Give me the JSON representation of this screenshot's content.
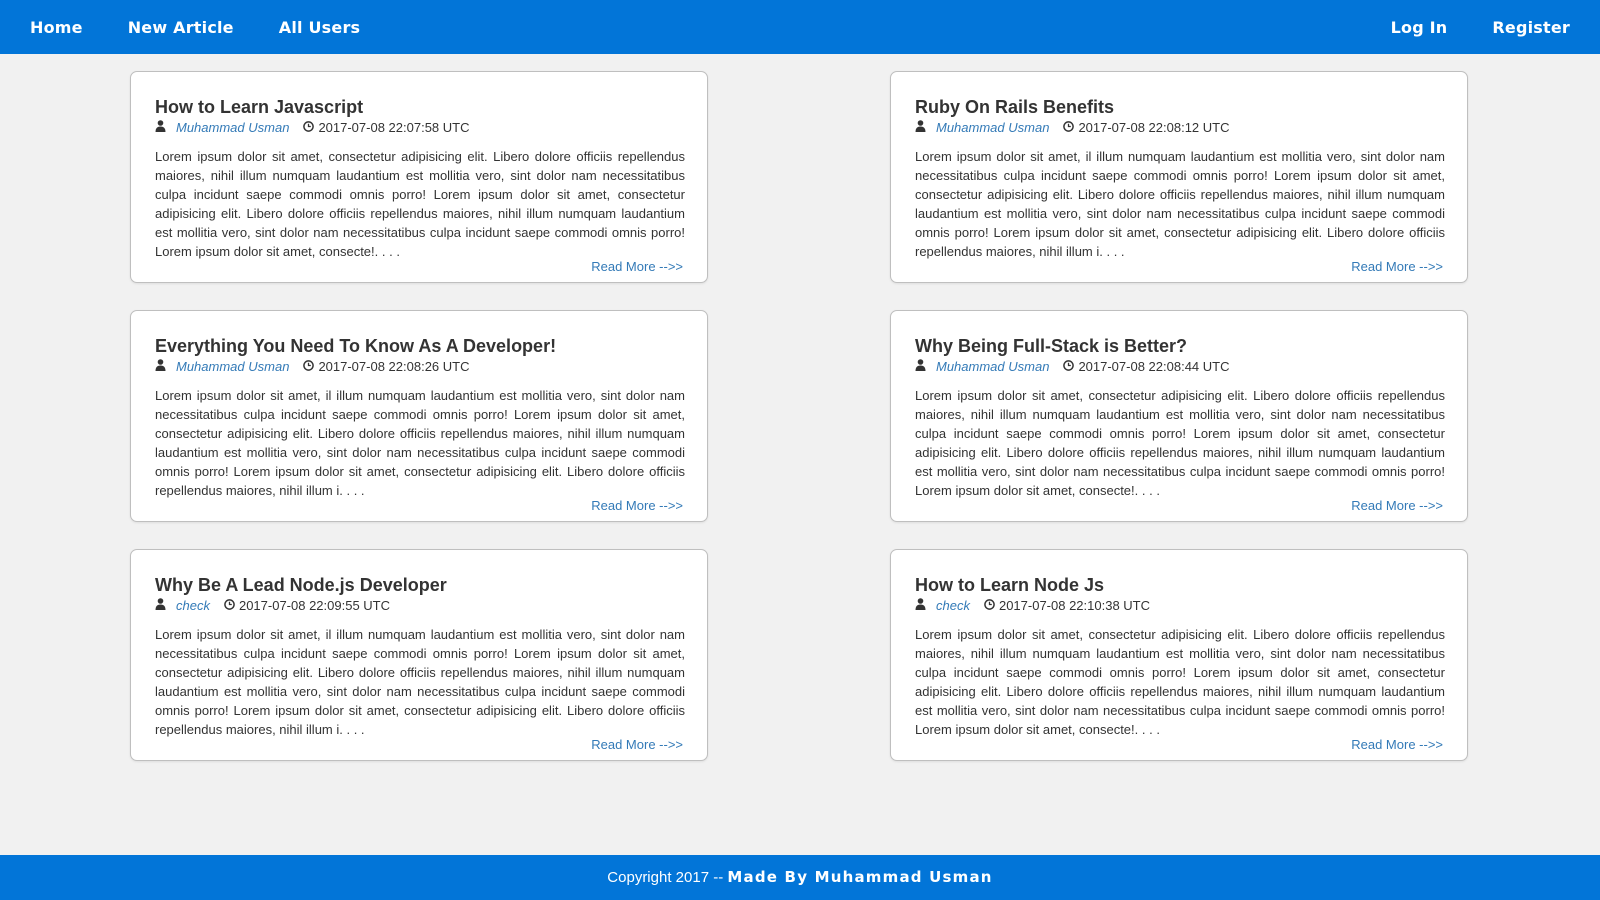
{
  "nav": {
    "left": [
      "Home",
      "New Article",
      "All Users"
    ],
    "right": [
      "Log In",
      "Register"
    ]
  },
  "articles": [
    {
      "title": "How to Learn Javascript",
      "author": "Muhammad Usman",
      "date": "2017-07-08 22:07:58 UTC",
      "excerpt": "Lorem ipsum dolor sit amet, consectetur adipisicing elit. Libero dolore officiis repellendus maiores, nihil illum numquam laudantium est mollitia vero, sint dolor nam necessitatibus culpa incidunt saepe commodi omnis porro! Lorem ipsum dolor sit amet, consectetur adipisicing elit. Libero dolore officiis repellendus maiores, nihil illum numquam laudantium est mollitia vero, sint dolor nam necessitatibus culpa incidunt saepe commodi omnis porro! Lorem ipsum dolor sit amet, consecte!. . . .",
      "read_more": "Read More -->>"
    },
    {
      "title": "Ruby On Rails Benefits",
      "author": "Muhammad Usman",
      "date": "2017-07-08 22:08:12 UTC",
      "excerpt": "Lorem ipsum dolor sit amet, il illum numquam laudantium est mollitia vero, sint dolor nam necessitatibus culpa incidunt saepe commodi omnis porro! Lorem ipsum dolor sit amet, consectetur adipisicing elit. Libero dolore officiis repellendus maiores, nihil illum numquam laudantium est mollitia vero, sint dolor nam necessitatibus culpa incidunt saepe commodi omnis porro! Lorem ipsum dolor sit amet, consectetur adipisicing elit. Libero dolore officiis repellendus maiores, nihil illum i. . . .",
      "read_more": "Read More -->>"
    },
    {
      "title": "Everything You Need To Know As A Developer!",
      "author": "Muhammad Usman",
      "date": "2017-07-08 22:08:26 UTC",
      "excerpt": "Lorem ipsum dolor sit amet, il illum numquam laudantium est mollitia vero, sint dolor nam necessitatibus culpa incidunt saepe commodi omnis porro! Lorem ipsum dolor sit amet, consectetur adipisicing elit. Libero dolore officiis repellendus maiores, nihil illum numquam laudantium est mollitia vero, sint dolor nam necessitatibus culpa incidunt saepe commodi omnis porro! Lorem ipsum dolor sit amet, consectetur adipisicing elit. Libero dolore officiis repellendus maiores, nihil illum i. . . .",
      "read_more": "Read More -->>"
    },
    {
      "title": "Why Being Full-Stack is Better?",
      "author": "Muhammad Usman",
      "date": "2017-07-08 22:08:44 UTC",
      "excerpt": "Lorem ipsum dolor sit amet, consectetur adipisicing elit. Libero dolore officiis repellendus maiores, nihil illum numquam laudantium est mollitia vero, sint dolor nam necessitatibus culpa incidunt saepe commodi omnis porro! Lorem ipsum dolor sit amet, consectetur adipisicing elit. Libero dolore officiis repellendus maiores, nihil illum numquam laudantium est mollitia vero, sint dolor nam necessitatibus culpa incidunt saepe commodi omnis porro! Lorem ipsum dolor sit amet, consecte!. . . .",
      "read_more": "Read More -->>"
    },
    {
      "title": "Why Be A Lead Node.js Developer",
      "author": "check",
      "date": "2017-07-08 22:09:55 UTC",
      "excerpt": "Lorem ipsum dolor sit amet, il illum numquam laudantium est mollitia vero, sint dolor nam necessitatibus culpa incidunt saepe commodi omnis porro! Lorem ipsum dolor sit amet, consectetur adipisicing elit. Libero dolore officiis repellendus maiores, nihil illum numquam laudantium est mollitia vero, sint dolor nam necessitatibus culpa incidunt saepe commodi omnis porro! Lorem ipsum dolor sit amet, consectetur adipisicing elit. Libero dolore officiis repellendus maiores, nihil illum i. . . .",
      "read_more": "Read More -->>"
    },
    {
      "title": "How to Learn Node Js",
      "author": "check",
      "date": "2017-07-08 22:10:38 UTC",
      "excerpt": "Lorem ipsum dolor sit amet, consectetur adipisicing elit. Libero dolore officiis repellendus maiores, nihil illum numquam laudantium est mollitia vero, sint dolor nam necessitatibus culpa incidunt saepe commodi omnis porro! Lorem ipsum dolor sit amet, consectetur adipisicing elit. Libero dolore officiis repellendus maiores, nihil illum numquam laudantium est mollitia vero, sint dolor nam necessitatibus culpa incidunt saepe commodi omnis porro! Lorem ipsum dolor sit amet, consecte!. . . .",
      "read_more": "Read More -->>"
    }
  ],
  "footer": {
    "copyright": "Copyright 2017 --",
    "made_by": "Made By Muhammad Usman"
  },
  "icons": {
    "author": "user-icon",
    "date": "clock-icon"
  },
  "colors": {
    "brand": "#0275d8",
    "link": "#337ab7",
    "background": "#f1f1f1"
  }
}
